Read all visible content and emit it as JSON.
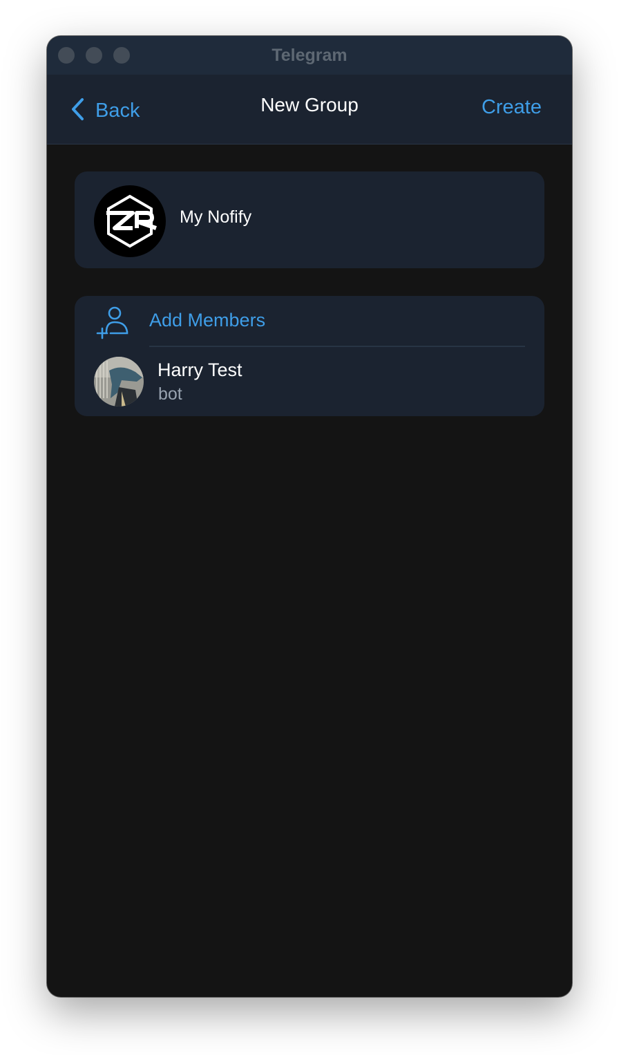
{
  "window": {
    "title": "Telegram"
  },
  "navbar": {
    "back_label": "Back",
    "title": "New Group",
    "create_label": "Create"
  },
  "group": {
    "name": "My Nofify",
    "avatar_icon": "zr-logo-icon"
  },
  "members_section": {
    "add_label": "Add Members",
    "add_icon": "add-person-icon",
    "members": [
      {
        "name": "Harry Test",
        "status": "bot"
      }
    ]
  },
  "colors": {
    "accent": "#3f9ee8",
    "card_bg": "#1b2330",
    "window_bg": "#141414",
    "titlebar_bg": "#1f2b3b"
  }
}
